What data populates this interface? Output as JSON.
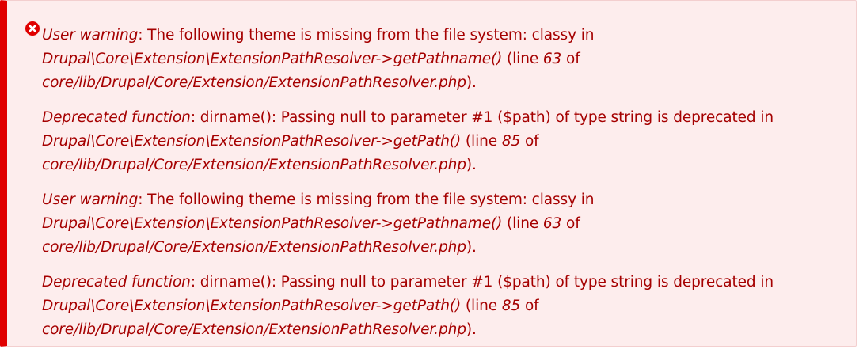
{
  "status": {
    "type": "error",
    "icon": "error-x-circle-icon",
    "colors": {
      "accent_border": "#e00000",
      "background": "#fdeded",
      "text": "#a50000"
    }
  },
  "messages": [
    {
      "type_label": "User warning",
      "text_after_type": ": The following theme is missing from the file system: classy in",
      "function_path": "Drupal\\Core\\Extension\\ExtensionPathResolver->getPathname()",
      "line_prefix": " (line ",
      "line_number": "63",
      "line_suffix": " of",
      "file_path": "core/lib/Drupal/Core/Extension/ExtensionPathResolver.php",
      "end": ")."
    },
    {
      "type_label": "Deprecated function",
      "text_after_type": ": dirname(): Passing null to parameter #1 ($path) of type string is deprecated in",
      "function_path": "Drupal\\Core\\Extension\\ExtensionPathResolver->getPath()",
      "line_prefix": " (line ",
      "line_number": "85",
      "line_suffix": " of",
      "file_path": "core/lib/Drupal/Core/Extension/ExtensionPathResolver.php",
      "end": ")."
    },
    {
      "type_label": "User warning",
      "text_after_type": ": The following theme is missing from the file system: classy in",
      "function_path": "Drupal\\Core\\Extension\\ExtensionPathResolver->getPathname()",
      "line_prefix": " (line ",
      "line_number": "63",
      "line_suffix": " of",
      "file_path": "core/lib/Drupal/Core/Extension/ExtensionPathResolver.php",
      "end": ")."
    },
    {
      "type_label": "Deprecated function",
      "text_after_type": ": dirname(): Passing null to parameter #1 ($path) of type string is deprecated in",
      "function_path": "Drupal\\Core\\Extension\\ExtensionPathResolver->getPath()",
      "line_prefix": " (line ",
      "line_number": "85",
      "line_suffix": " of",
      "file_path": "core/lib/Drupal/Core/Extension/ExtensionPathResolver.php",
      "end": ")."
    }
  ]
}
